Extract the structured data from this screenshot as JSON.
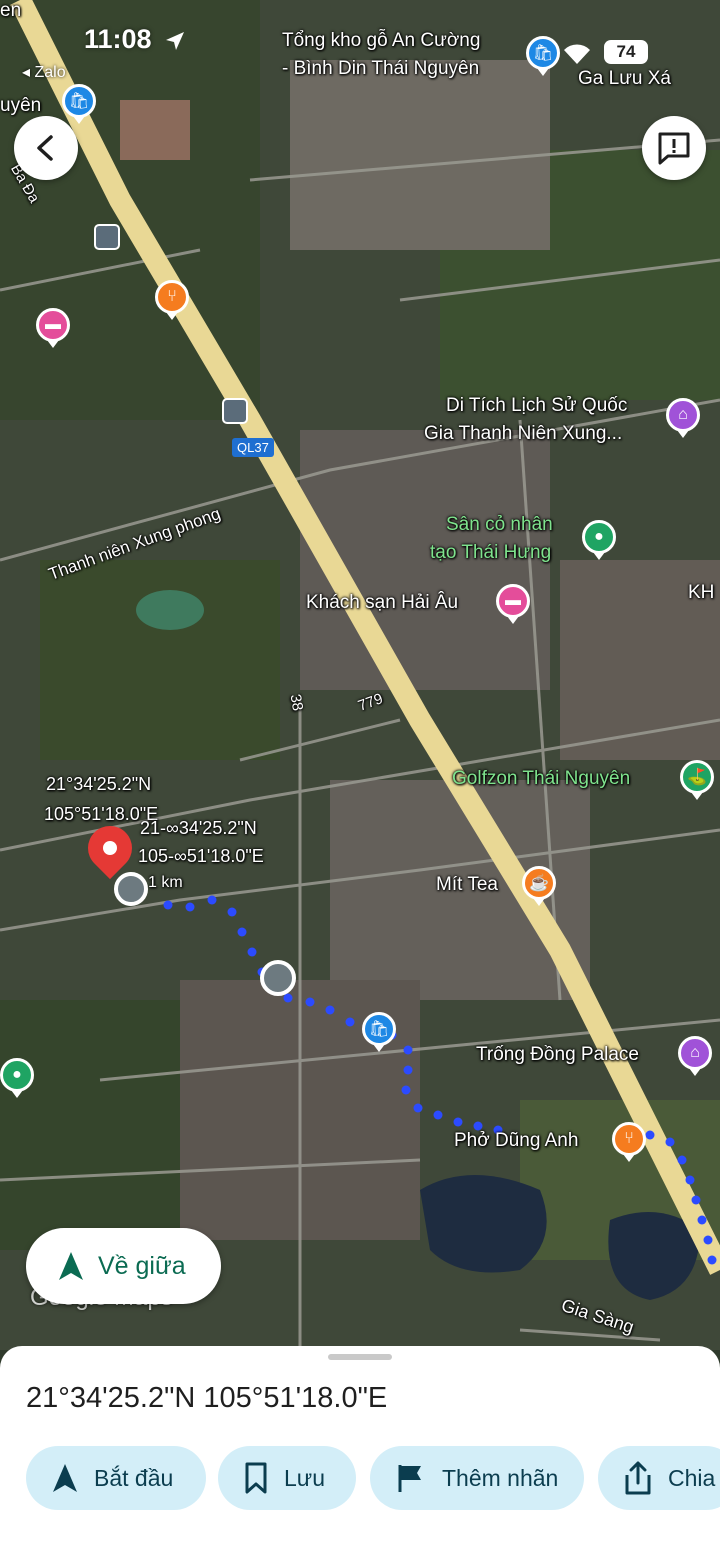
{
  "status": {
    "time": "11:08",
    "back_app": "◂ Zalo",
    "battery": "74"
  },
  "map": {
    "labels": {
      "tong_kho_line1": "Tổng kho gỗ An Cường",
      "tong_kho_line2": "- Bình Din Thái Nguyên",
      "ga_luu_xa": "Ga Lưu Xá",
      "ql37": "QL37",
      "di_tich_line1": "Di Tích Lịch Sử Quốc",
      "di_tich_line2": "Gia Thanh Niên Xung...",
      "thanh_nien": "Thanh niên Xung phong",
      "san_co_line1": "Sân cỏ nhân",
      "san_co_line2": "tạo Thái Hưng",
      "khach_san": "Khách sạn Hải Âu",
      "road_38": "38",
      "road_779": "779",
      "golfzon": "Golfzon Thái Nguyên",
      "coord_lat": "21°34'25.2\"N",
      "coord_lng": "105°51'18.0\"E",
      "coord_lat2": "21-∞34'25.2\"N",
      "coord_lng2": "105-∞51'18.0\"E",
      "dist": "1 km",
      "mit_tea": "Mít Tea",
      "trong_dong": "Trống Đồng Palace",
      "pho_dung": "Phở Dũng Anh",
      "gia_sang": "Gia Sàng",
      "kh": "KH",
      "ba_da": "Ba Đa",
      "nguyen": "uyên",
      "en": "en"
    }
  },
  "controls": {
    "recenter_label": "Về giữa",
    "watermark": "Google Maps"
  },
  "sheet": {
    "coordinates": "21°34'25.2\"N 105°51'18.0\"E",
    "actions": {
      "start": "Bắt đầu",
      "save": "Lưu",
      "label": "Thêm nhãn",
      "share": "Chia"
    }
  },
  "colors": {
    "accent": "#0b6b52",
    "chip": "#d3eef8",
    "route": "#1a3dff",
    "pin_red": "#e53935",
    "highway": "#e8d48f"
  }
}
